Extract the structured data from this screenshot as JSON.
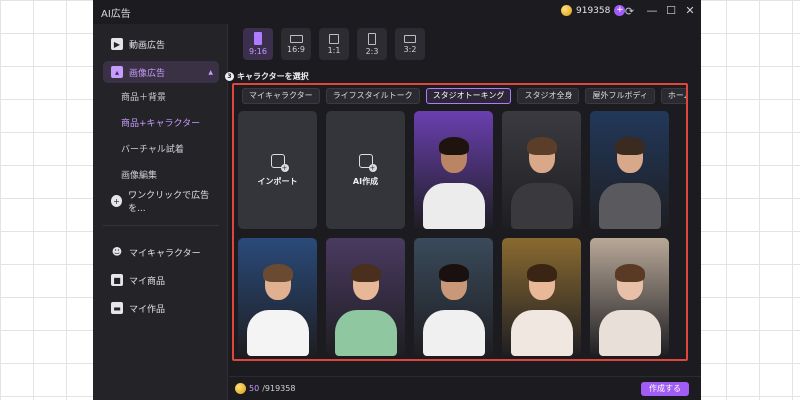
{
  "window": {
    "title": "AI広告",
    "credits": "919358"
  },
  "sidebar": {
    "items": [
      {
        "label": "動画広告",
        "icon": "video-ad-icon"
      },
      {
        "label": "画像広告",
        "icon": "image-ad-icon",
        "active": true
      },
      {
        "label": "ワンクリックで広告を...",
        "icon": "one-click-ad-icon"
      },
      {
        "label": "マイキャラクター",
        "icon": "my-character-icon"
      },
      {
        "label": "マイ商品",
        "icon": "my-products-icon"
      },
      {
        "label": "マイ作品",
        "icon": "my-works-icon"
      }
    ],
    "sub_items": [
      {
        "label": "商品＋背景"
      },
      {
        "label": "商品+キャラクター",
        "active": true
      },
      {
        "label": "バーチャル試着"
      },
      {
        "label": "画像編集"
      }
    ]
  },
  "ratios": [
    {
      "label": "9:16",
      "active": true
    },
    {
      "label": "16:9"
    },
    {
      "label": "1:1"
    },
    {
      "label": "2:3"
    },
    {
      "label": "3:2"
    }
  ],
  "step": {
    "number": "3",
    "label": "キャラクターを選択"
  },
  "tabs": [
    {
      "label": "マイキャラクター"
    },
    {
      "label": "ライフスタイルトーク"
    },
    {
      "label": "スタジオトーキング",
      "active": true
    },
    {
      "label": "スタジオ全身"
    },
    {
      "label": "屋外フルボディ"
    },
    {
      "label": "ホームフルボディ"
    }
  ],
  "actions": [
    {
      "label": "インポート",
      "icon": "import-icon"
    },
    {
      "label": "AI作成",
      "icon": "ai-create-icon"
    }
  ],
  "characters": [
    {
      "id": "c1",
      "bg": "#6a3fb0",
      "skin": "#b98565",
      "hair": "#1e130d",
      "shirt": "#ececec"
    },
    {
      "id": "c2",
      "bg": "#3a3a40",
      "skin": "#d9a888",
      "hair": "#5a3e2a",
      "shirt": "#3a3a3e"
    },
    {
      "id": "c3",
      "bg": "#22385a",
      "skin": "#d8a88a",
      "hair": "#3a2a20",
      "shirt": "#5a5a5e"
    },
    {
      "id": "c4",
      "bg": "#2a4a7a",
      "skin": "#e0b090",
      "hair": "#6a4a30",
      "shirt": "#f4f4f4"
    },
    {
      "id": "c5",
      "bg": "#4a3a60",
      "skin": "#e6b898",
      "hair": "#4a2e1e",
      "shirt": "#8fc8a0"
    },
    {
      "id": "c6",
      "bg": "#3a4a5a",
      "skin": "#c89878",
      "hair": "#1a1010",
      "shirt": "#f0f0f0"
    },
    {
      "id": "c7",
      "bg": "#8a6a30",
      "skin": "#e8b898",
      "hair": "#3a2414",
      "shirt": "#f0e8e0"
    },
    {
      "id": "c8",
      "bg": "#b8a898",
      "skin": "#e8c0a8",
      "hair": "#5a3a24",
      "shirt": "#e8e0d8"
    }
  ],
  "footer": {
    "used": "50",
    "total": "/919358",
    "create_label": "作成する"
  },
  "colors": {
    "accent": "#a15cf5",
    "highlight_border": "#e0463c",
    "background": "#1c1c20"
  }
}
